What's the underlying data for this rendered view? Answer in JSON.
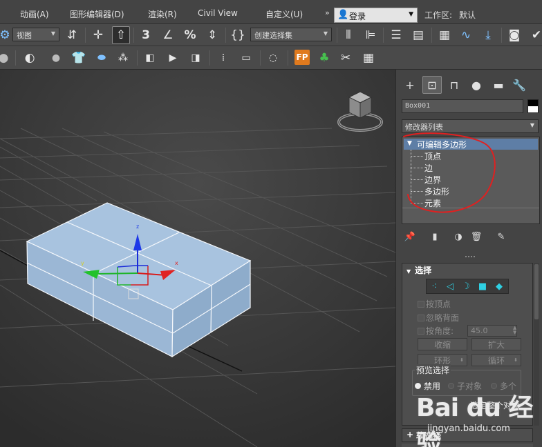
{
  "menubar": {
    "items": [
      "动画(A)",
      "图形编辑器(D)",
      "渲染(R)",
      "Civil View",
      "自定义(U)"
    ],
    "more": "»",
    "login": "登录",
    "workspace_label": "工作区:",
    "workspace_value": "默认"
  },
  "toolbar1": {
    "view_dropdown": "视图",
    "snap_labels": [
      "3",
      "%"
    ],
    "selection_set": "创建选择集"
  },
  "toolbar2": {
    "fp_label": "FP"
  },
  "viewport": {
    "gizmo_labels": {
      "z": "z",
      "x": "x",
      "y": "y"
    }
  },
  "panel": {
    "object_name": "Box001",
    "modifier_list": "修改器列表",
    "stack": {
      "root": "可编辑多边形",
      "sub_objects": [
        "顶点",
        "边",
        "边界",
        "多边形",
        "元素"
      ]
    },
    "rollout": {
      "title": "选择",
      "by_vertex": "按顶点",
      "ignore_backfacing": "忽略背面",
      "by_angle": "按角度:",
      "angle_value": "45.0",
      "shrink": "收缩",
      "grow": "扩大",
      "ring": "环形",
      "loop": "循环",
      "preview_title": "预览选择",
      "preview_options": [
        "禁用",
        "子对象",
        "多个"
      ],
      "select_whole": "选定整个对象"
    },
    "soft_selection": "软选择"
  },
  "watermark": {
    "logo": "Bai du 经验",
    "url": "jingyan.baidu.com"
  },
  "colors": {
    "box_face": "#a8c3df",
    "stack_highlight": "#5e7ea6",
    "annotation_red": "#e02020",
    "fp_orange": "#e07a1e"
  }
}
